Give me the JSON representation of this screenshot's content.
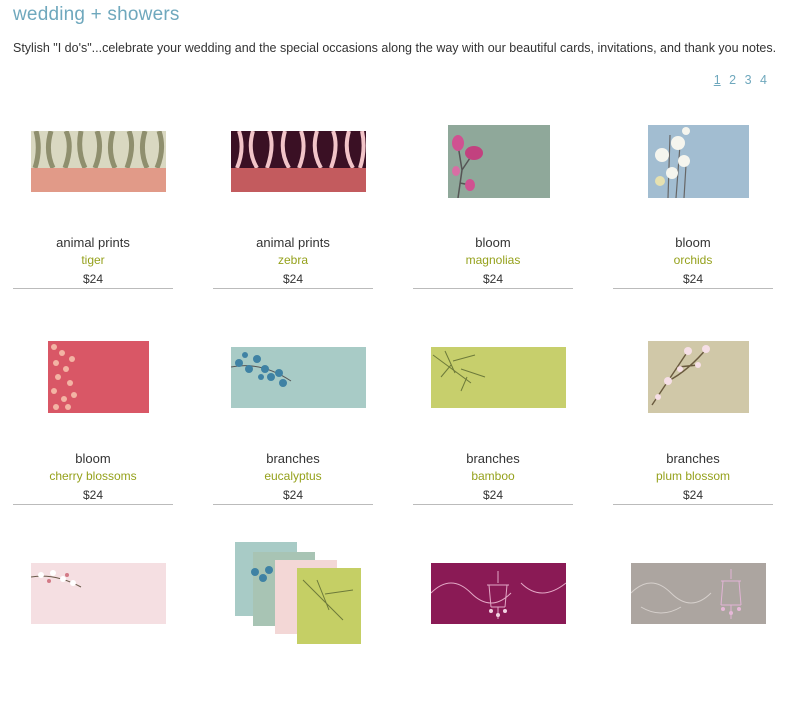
{
  "header": {
    "title": "wedding + showers",
    "intro": "Stylish \"I do's\"...celebrate your wedding and the special occasions along the way with our beautiful cards, invitations, and thank you notes."
  },
  "pagination": {
    "pages": [
      "1",
      "2",
      "3",
      "4"
    ],
    "current": "1"
  },
  "products": [
    {
      "name": "animal prints",
      "variant": "tiger",
      "price": "$24",
      "icon": "tiger-stripe-card-image"
    },
    {
      "name": "animal prints",
      "variant": "zebra",
      "price": "$24",
      "icon": "zebra-stripe-card-image"
    },
    {
      "name": "bloom",
      "variant": "magnolias",
      "price": "$24",
      "icon": "magnolia-card-image"
    },
    {
      "name": "bloom",
      "variant": "orchids",
      "price": "$24",
      "icon": "orchid-card-image"
    },
    {
      "name": "bloom",
      "variant": "cherry blossoms",
      "price": "$24",
      "icon": "cherry-blossom-card-image"
    },
    {
      "name": "branches",
      "variant": "eucalyptus",
      "price": "$24",
      "icon": "eucalyptus-card-image"
    },
    {
      "name": "branches",
      "variant": "bamboo",
      "price": "$24",
      "icon": "bamboo-card-image"
    },
    {
      "name": "branches",
      "variant": "plum blossom",
      "price": "$24",
      "icon": "plum-blossom-card-image"
    },
    {
      "icon": "pink-blossom-card-image"
    },
    {
      "icon": "branches-collection-card-image"
    },
    {
      "icon": "magenta-chandelier-card-image"
    },
    {
      "icon": "taupe-chandelier-card-image"
    }
  ],
  "colors": {
    "title": "#6fa8bd",
    "variant": "#95a11c",
    "rule": "#bbbbbb"
  }
}
